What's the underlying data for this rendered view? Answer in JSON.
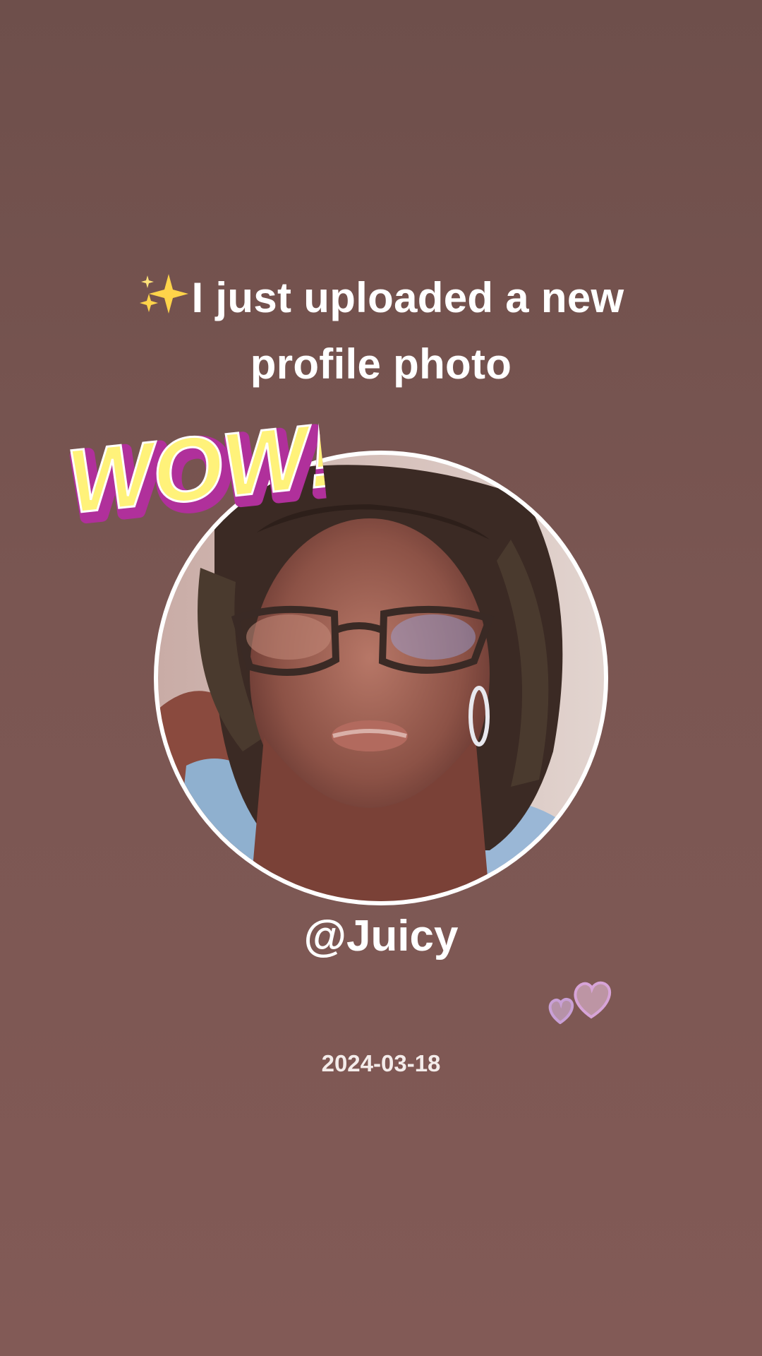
{
  "post": {
    "headline": "I just uploaded a new profile photo",
    "username": "@Juicy",
    "date": "2024-03-18"
  },
  "stickers": {
    "wow_text": "WOW!"
  },
  "icons": {
    "headline_prefix": "sparkles-icon",
    "decoration": "hearts-icon"
  },
  "colors": {
    "background": "#7a5652",
    "text": "#ffffff",
    "ring": "#ffffff",
    "wow_fill": "#fff27a",
    "wow_outline": "#b0309b",
    "sparkle": "#ffd44a"
  }
}
